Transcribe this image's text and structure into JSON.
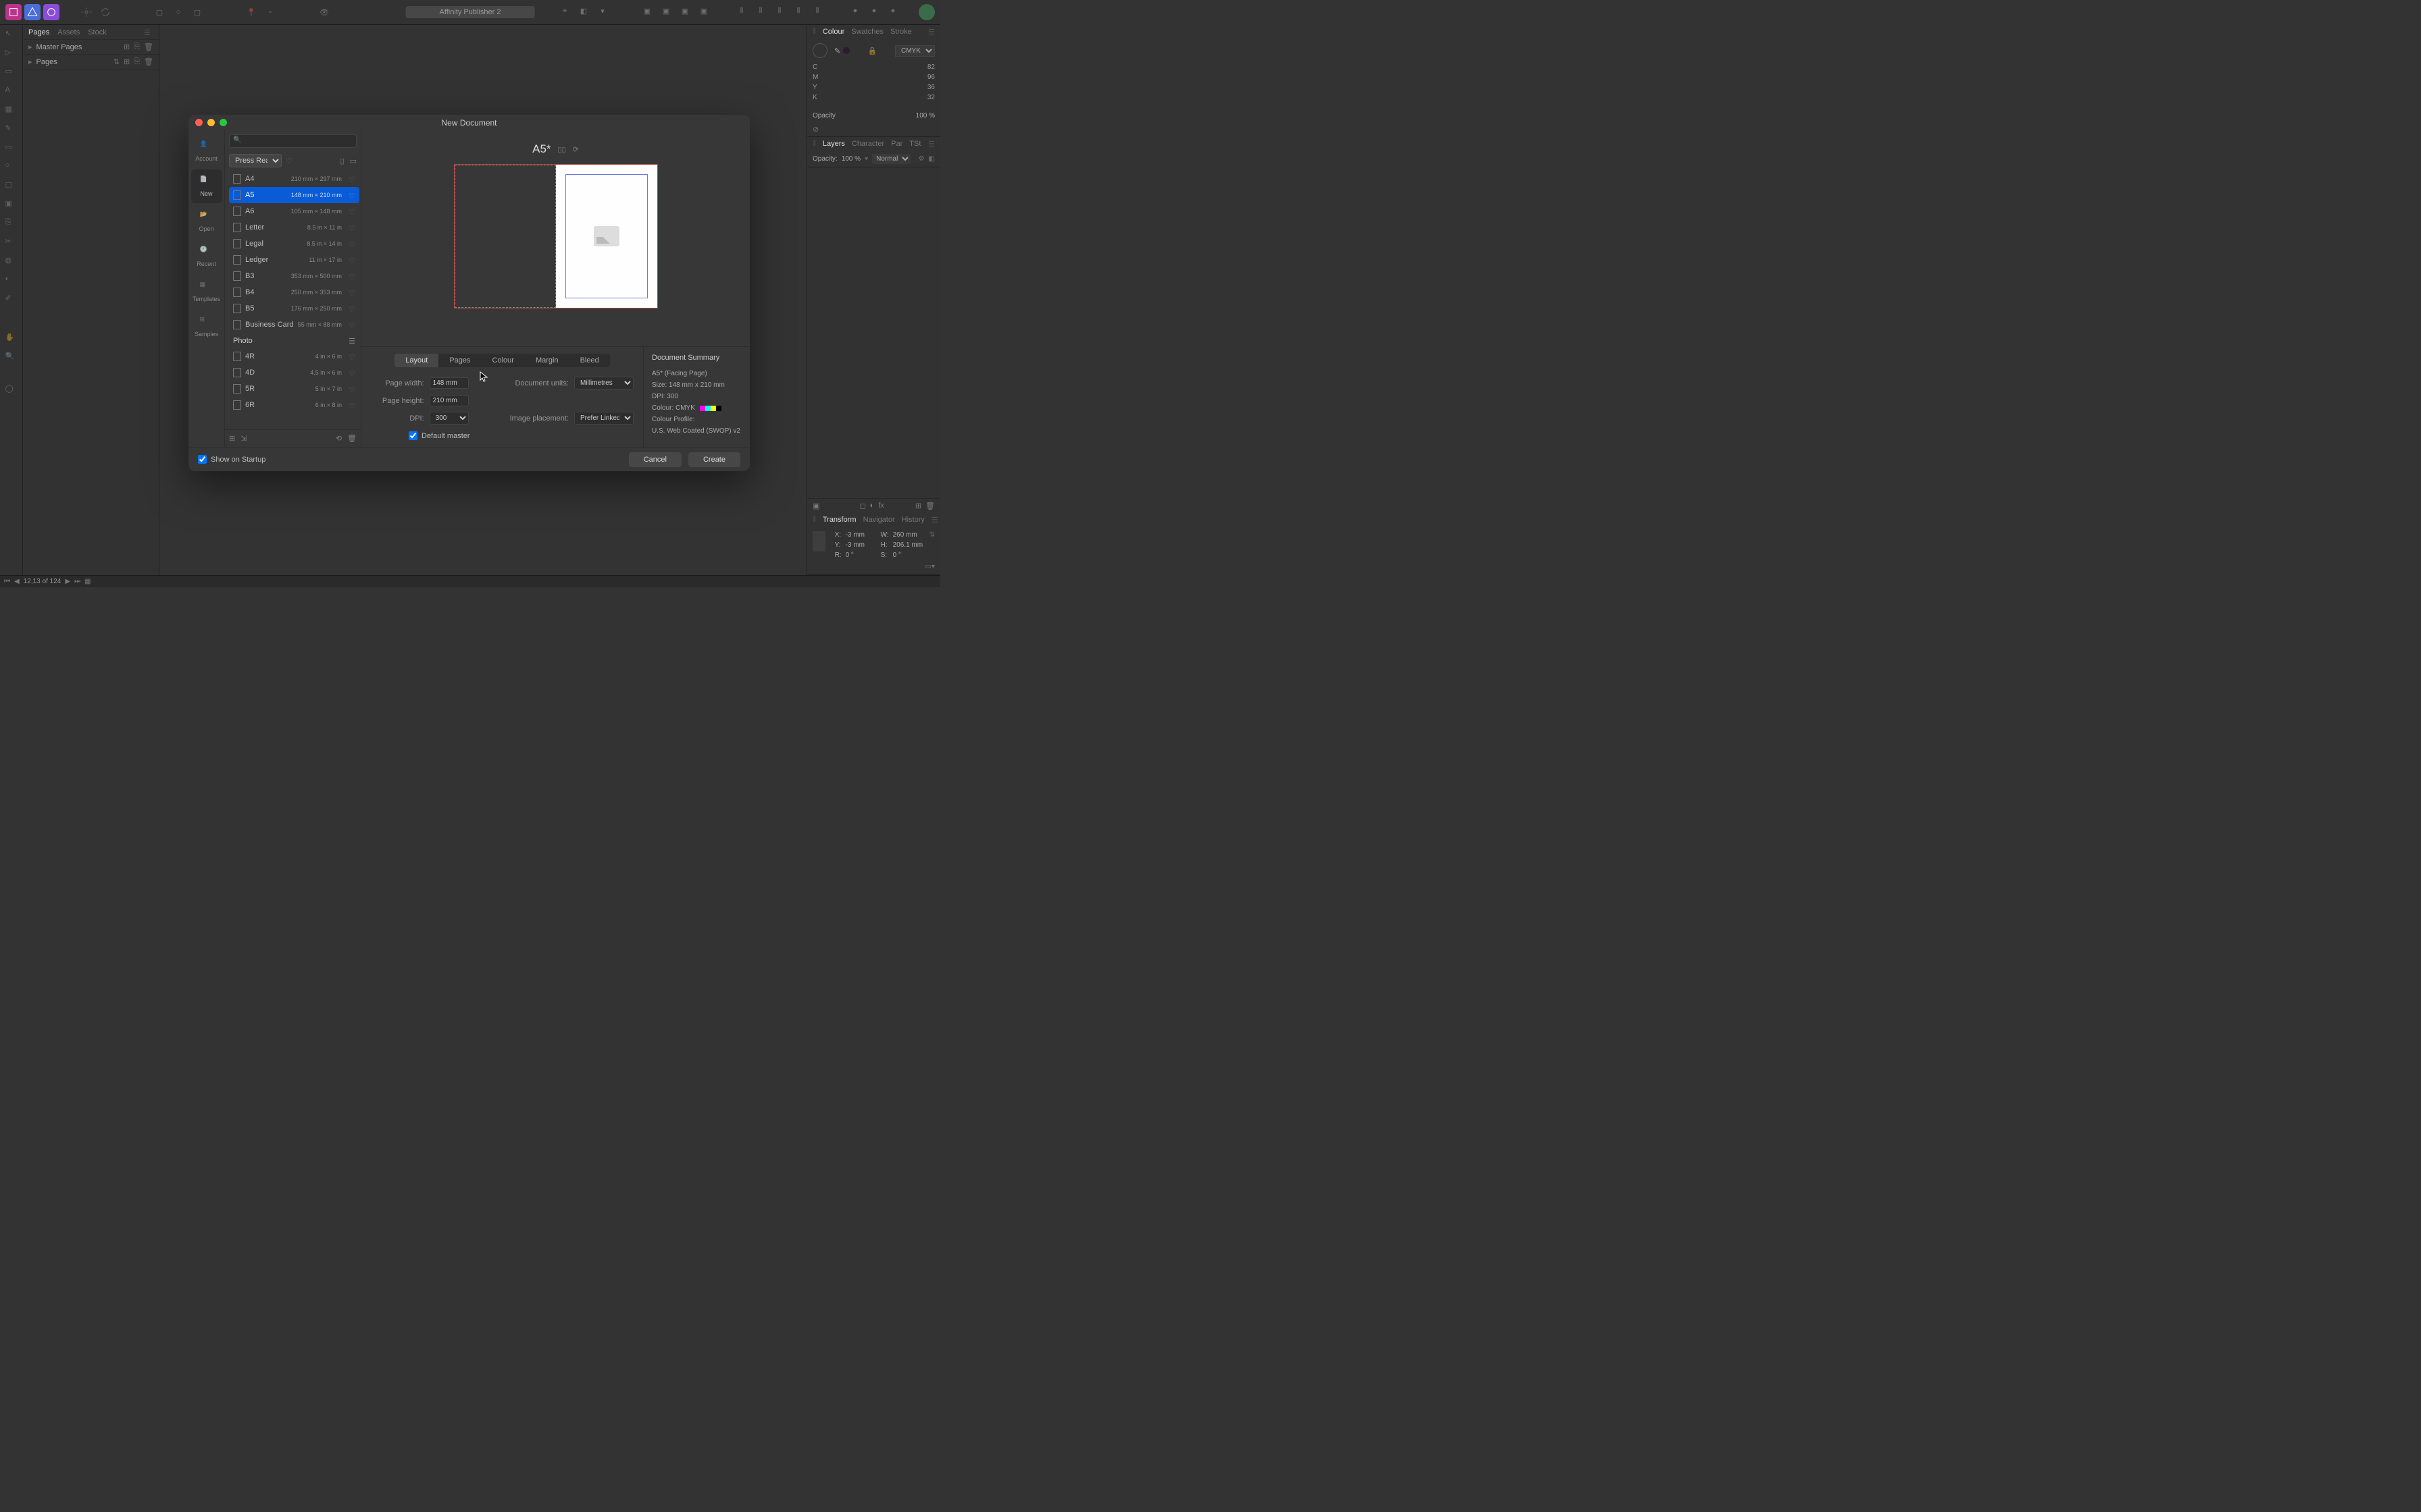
{
  "app_title": "Affinity Publisher 2",
  "left_panel": {
    "tabs": [
      "Pages",
      "Assets",
      "Stock"
    ],
    "active_tab": "Pages",
    "master_pages_label": "Master Pages",
    "pages_label": "Pages"
  },
  "colour_panel": {
    "tabs": [
      "Colour",
      "Swatches",
      "Stroke"
    ],
    "active_tab": "Colour",
    "model": "CMYK",
    "sliders": {
      "C": "82",
      "M": "96",
      "Y": "36",
      "K": "32"
    },
    "opacity_label": "Opacity",
    "opacity_value": "100 %"
  },
  "layers_panel": {
    "tabs": [
      "Layers",
      "Character",
      "Par",
      "TSt"
    ],
    "active_tab": "Layers",
    "opacity_label": "Opacity:",
    "opacity_value": "100 %",
    "blend_mode": "Normal"
  },
  "transform_panel": {
    "tabs": [
      "Transform",
      "Navigator",
      "History"
    ],
    "active_tab": "Transform",
    "X_label": "X:",
    "X_value": "-3 mm",
    "Y_label": "Y:",
    "Y_value": "-3 mm",
    "W_label": "W:",
    "W_value": "260 mm",
    "H_label": "H:",
    "H_value": "206.1 mm",
    "R_label": "R:",
    "R_value": "0 °",
    "S_label": "S:",
    "S_value": "0 °"
  },
  "status_bar": {
    "page_counter": "12,13 of 124"
  },
  "modal": {
    "title": "New Document",
    "left_items": [
      {
        "label": "Account"
      },
      {
        "label": "New",
        "active": true
      },
      {
        "label": "Open"
      },
      {
        "label": "Recent"
      },
      {
        "label": "Templates"
      },
      {
        "label": "Samples"
      }
    ],
    "search_placeholder": "",
    "preset_group": "Press Ready",
    "presets": [
      {
        "name": "A4",
        "dims": "210 mm × 297 mm"
      },
      {
        "name": "A5",
        "dims": "148 mm × 210 mm",
        "selected": true
      },
      {
        "name": "A6",
        "dims": "105 mm × 148 mm"
      },
      {
        "name": "Letter",
        "dims": "8.5 in × 11 in"
      },
      {
        "name": "Legal",
        "dims": "8.5 in × 14 in"
      },
      {
        "name": "Ledger",
        "dims": "11 in × 17 in"
      },
      {
        "name": "B3",
        "dims": "353 mm × 500 mm"
      },
      {
        "name": "B4",
        "dims": "250 mm × 353 mm"
      },
      {
        "name": "B5",
        "dims": "176 mm × 250 mm"
      },
      {
        "name": "Business Card",
        "dims": "55 mm × 88 mm"
      }
    ],
    "photo_group_label": "Photo",
    "photo_presets": [
      {
        "name": "4R",
        "dims": "4 in × 6 in"
      },
      {
        "name": "4D",
        "dims": "4.5 in × 6 in"
      },
      {
        "name": "5R",
        "dims": "5 in × 7 in"
      },
      {
        "name": "6R",
        "dims": "6 in × 8 in"
      }
    ],
    "preview_name": "A5*",
    "config_tabs": [
      "Layout",
      "Pages",
      "Colour",
      "Margin",
      "Bleed"
    ],
    "config_active": "Layout",
    "fields": {
      "page_width_label": "Page width:",
      "page_width_value": "148 mm",
      "page_height_label": "Page height:",
      "page_height_value": "210 mm",
      "dpi_label": "DPI:",
      "dpi_value": "300",
      "doc_units_label": "Document units:",
      "doc_units_value": "Millimetres",
      "image_placement_label": "Image placement:",
      "image_placement_value": "Prefer Linked",
      "default_master_label": "Default master"
    },
    "summary": {
      "title": "Document Summary",
      "line1": "A5* (Facing Page)",
      "line2": "Size: 148 mm x 210 mm",
      "line3": "DPI:  300",
      "line4_label": "Colour: CMYK",
      "line5_label": "Colour Profile:",
      "line5_value": "U.S. Web Coated (SWOP) v2"
    },
    "show_startup_label": "Show on Startup",
    "cancel_label": "Cancel",
    "create_label": "Create"
  }
}
